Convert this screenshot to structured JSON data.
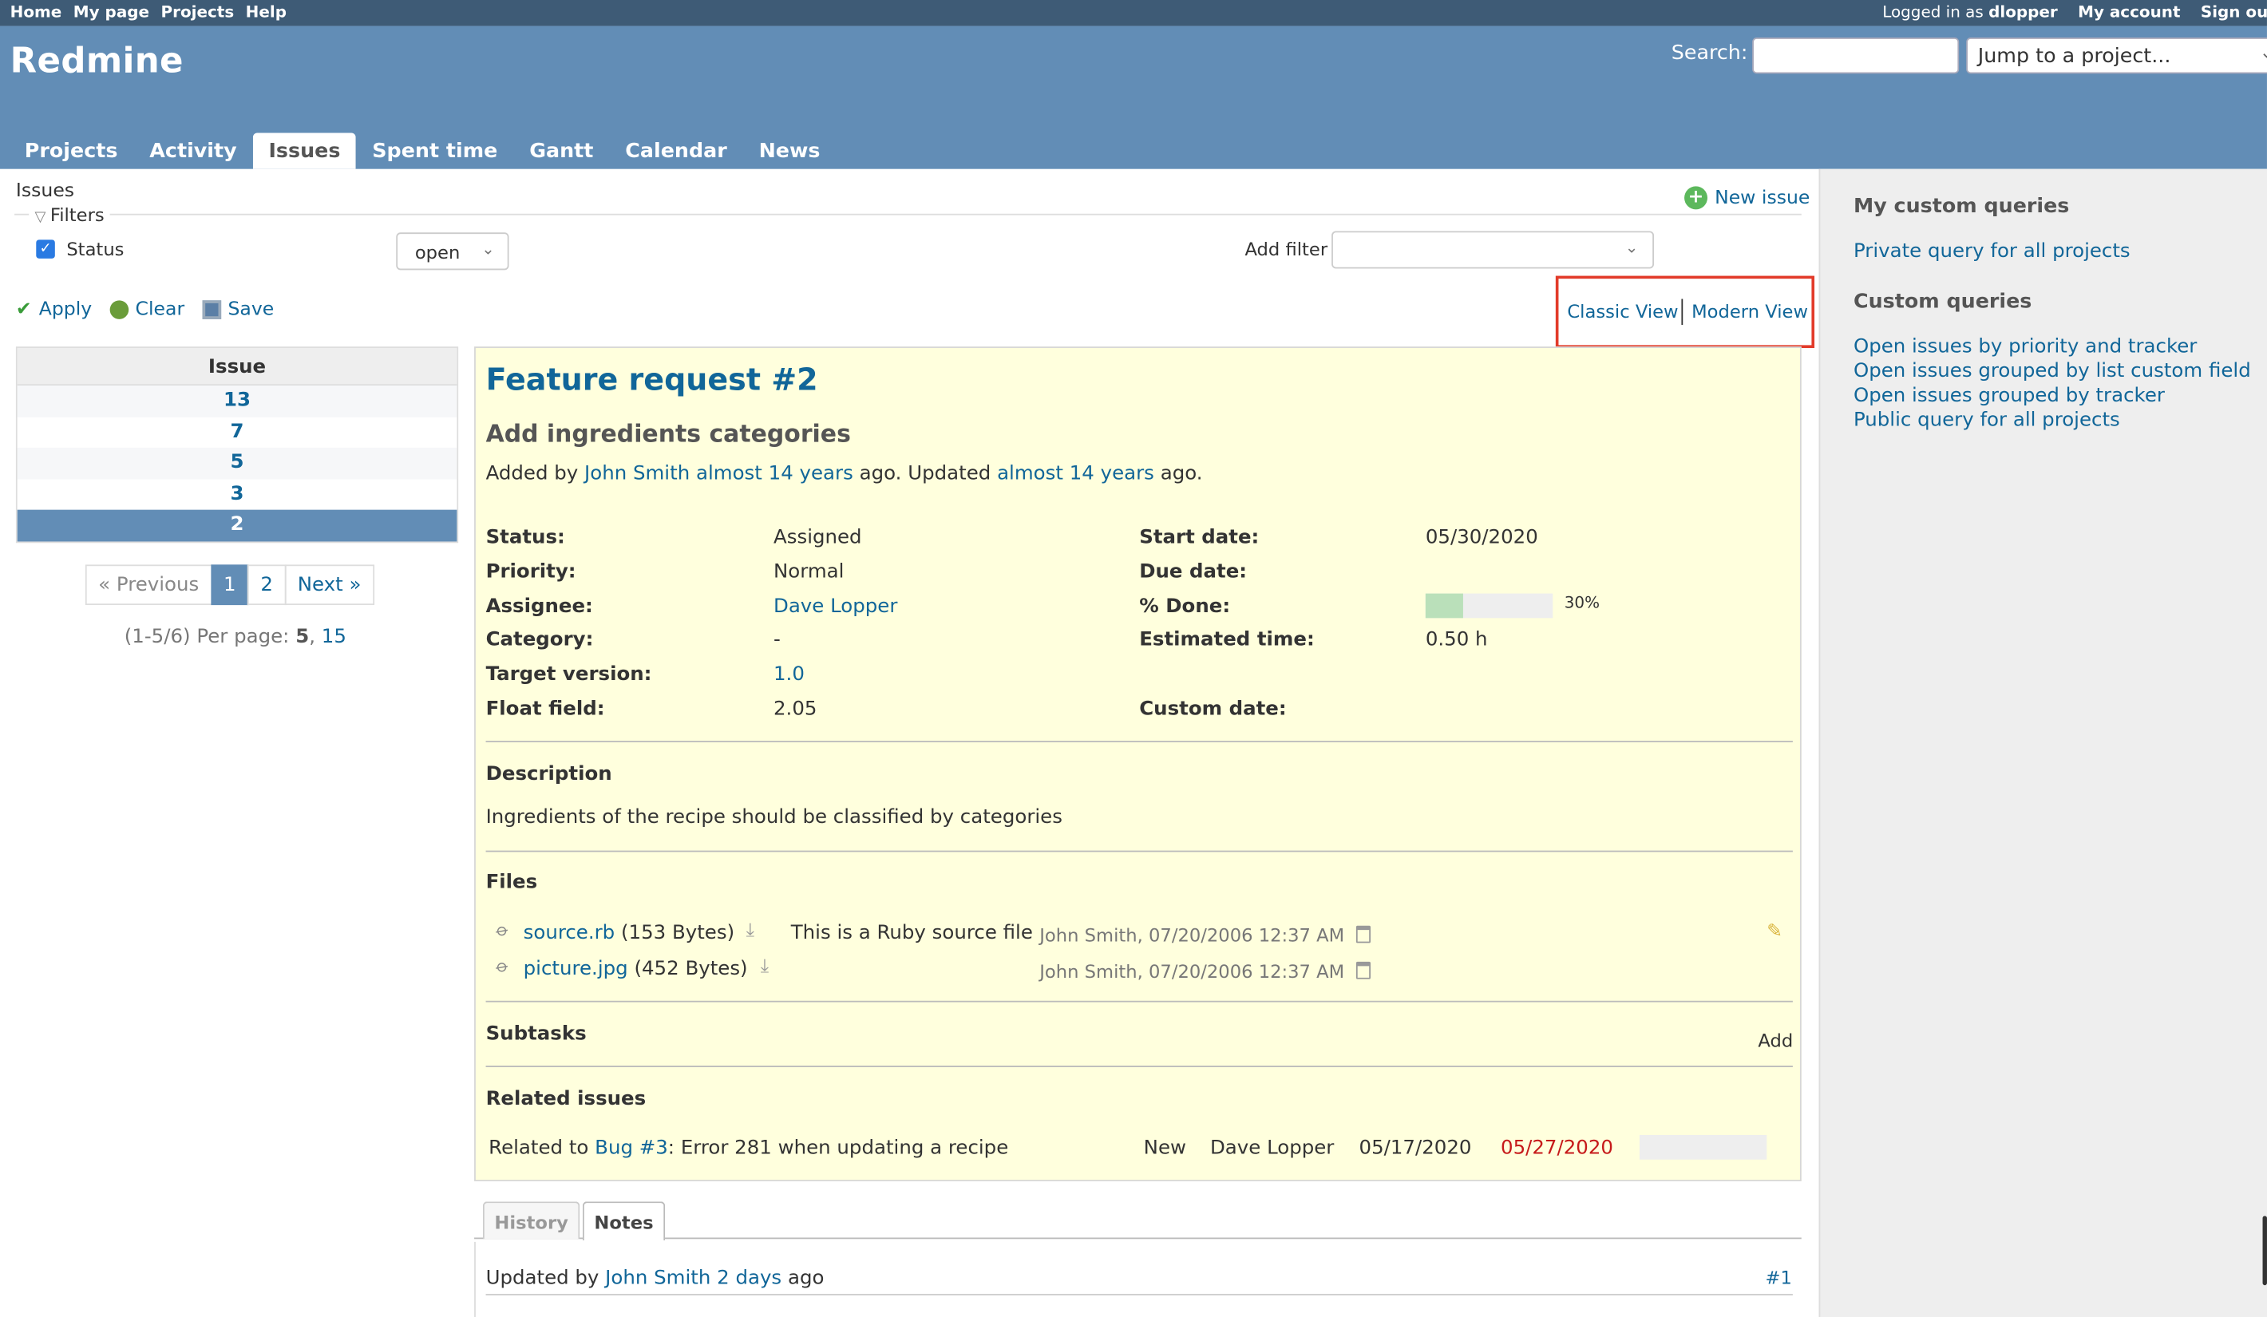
{
  "top_menu": {
    "left": [
      "Home",
      "My page",
      "Projects",
      "Help"
    ],
    "logged_in_prefix": "Logged in as",
    "logged_in_user": "dlopper",
    "my_account": "My account",
    "sign_out": "Sign out"
  },
  "header": {
    "title": "Redmine",
    "search_label": "Search:",
    "jump_placeholder": "Jump to a project...",
    "tabs": [
      "Projects",
      "Activity",
      "Issues",
      "Spent time",
      "Gantt",
      "Calendar",
      "News"
    ],
    "selected_tab": "Issues"
  },
  "content": {
    "title": "Issues",
    "filters_legend": "Filters",
    "status_label": "Status",
    "status_value": "open",
    "add_filter_label": "Add filter",
    "new_issue": "New issue",
    "actions": {
      "apply": "Apply",
      "clear": "Clear",
      "save": "Save"
    },
    "classic_view": "Classic View",
    "modern_view": "Modern View"
  },
  "issue_list": {
    "header": "Issue",
    "rows": [
      "13",
      "7",
      "5",
      "3",
      "2"
    ],
    "selected": "2"
  },
  "pagination": {
    "previous": "« Previous",
    "pages": [
      "1",
      "2"
    ],
    "current": "1",
    "next": "Next »",
    "summary": "(1-5/6) Per page:",
    "per_page_current": "5",
    "per_page_other": "15"
  },
  "issue": {
    "tracker_title": "Feature request #2",
    "subject": "Add ingredients categories",
    "added_by_prefix": "Added by",
    "author": "John Smith",
    "created_ago": "almost 14 years",
    "updated_mid": "ago. Updated",
    "updated_ago": "almost 14 years",
    "ago_suffix": "ago.",
    "left_attributes": [
      {
        "label": "Status:",
        "value": "Assigned",
        "link": false
      },
      {
        "label": "Priority:",
        "value": "Normal",
        "link": false
      },
      {
        "label": "Assignee:",
        "value": "Dave Lopper",
        "link": true
      },
      {
        "label": "Category:",
        "value": "-",
        "link": false
      },
      {
        "label": "Target version:",
        "value": "1.0",
        "link": true
      },
      {
        "label": "Float field:",
        "value": "2.05",
        "link": false
      }
    ],
    "right_attributes": [
      {
        "label": "Start date:",
        "value": "05/30/2020"
      },
      {
        "label": "Due date:",
        "value": ""
      },
      {
        "label": "% Done:",
        "value": ""
      },
      {
        "label": "Estimated time:",
        "value": "0.50 h"
      },
      {
        "label": "",
        "value": ""
      },
      {
        "label": "Custom date:",
        "value": ""
      }
    ],
    "done_percent_label": "30%",
    "done_fraction": 0.3,
    "description_heading": "Description",
    "description": "Ingredients of the recipe should be classified by categories",
    "files_heading": "Files",
    "files": [
      {
        "name": "source.rb",
        "size": "(153 Bytes)",
        "description": "This is a Ruby source file",
        "meta": "John Smith, 07/20/2006 12:37 AM"
      },
      {
        "name": "picture.jpg",
        "size": "(452 Bytes)",
        "description": "",
        "meta": "John Smith, 07/20/2006 12:37 AM"
      }
    ],
    "subtasks_heading": "Subtasks",
    "subtasks_add": "Add",
    "related_heading": "Related issues",
    "related": {
      "prefix": "Related to",
      "link": "Bug #3",
      "subject": ": Error 281 when updating a recipe",
      "status": "New",
      "assignee": "Dave Lopper",
      "start": "05/17/2020",
      "due": "05/27/2020",
      "due_color": "#c61a1a"
    }
  },
  "history": {
    "tabs": [
      "History",
      "Notes"
    ],
    "selected": "Notes",
    "journal_prefix": "Updated by",
    "journal_author": "John Smith",
    "journal_ago": "2 days",
    "journal_suffix": "ago",
    "journal_number": "#1"
  },
  "sidebar": {
    "my_queries_heading": "My custom queries",
    "my_queries": [
      "Private query for all projects"
    ],
    "custom_queries_heading": "Custom queries",
    "custom_queries": [
      "Open issues by priority and tracker",
      "Open issues grouped by list custom field",
      "Open issues grouped by tracker",
      "Public query for all projects"
    ]
  },
  "colors": {
    "header_bg": "#628db6",
    "top_menu_bg": "#3e5b76",
    "link": "#116699",
    "issue_bg": "#ffffdd",
    "highlight_box": "#e23b2a"
  }
}
